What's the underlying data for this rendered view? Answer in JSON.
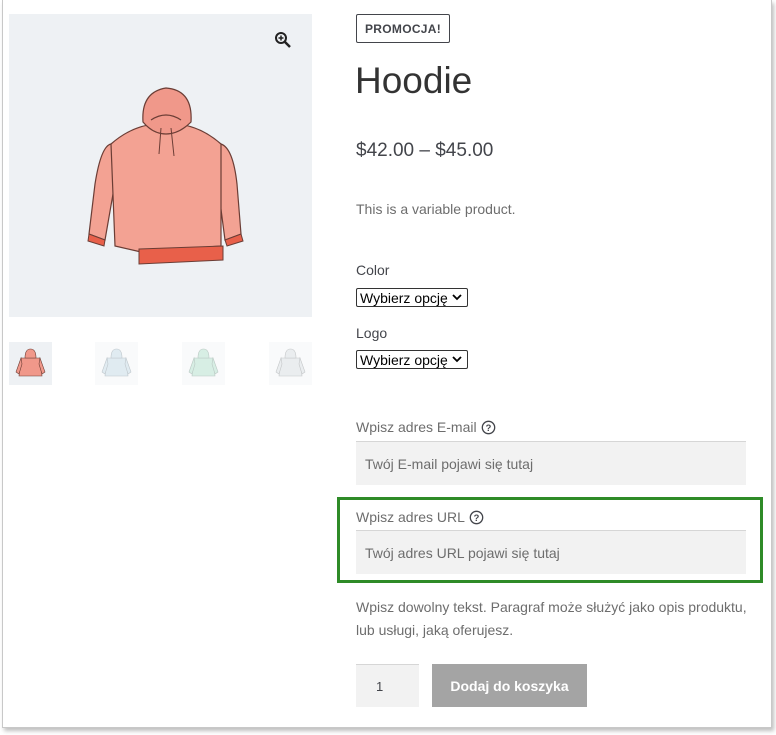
{
  "product": {
    "badge": "PROMOCJA!",
    "title": "Hoodie",
    "price": "$42.00 – $45.00",
    "description": "This is a variable product."
  },
  "gallery": {
    "zoom_icon": "magnifier-zoom-icon",
    "main_image": "hoodie-image",
    "thumbnails": [
      "hoodie-red",
      "hoodie-blue",
      "hoodie-green",
      "hoodie-grey"
    ],
    "colors": {
      "hoodie": "#f0988a",
      "hoodie_trim": "#e8604a",
      "background": "#eef1f4"
    }
  },
  "variations": {
    "color_label": "Color",
    "color_selected": "Wybierz opcję",
    "logo_label": "Logo",
    "logo_selected": "Wybierz opcję"
  },
  "fields": {
    "email_label": "Wpisz adres E-mail",
    "email_placeholder": "Twój E-mail pojawi się tutaj",
    "url_label": "Wpisz adres URL",
    "url_placeholder": "Twój adres URL pojawi się tutaj"
  },
  "paragraph": "Wpisz dowolny tekst. Paragraf może służyć jako opis produktu, lub usługi, jaką oferujesz.",
  "cart": {
    "quantity": "1",
    "add_button": "Dodaj do koszyka"
  },
  "highlight_color": "#2e8b28"
}
